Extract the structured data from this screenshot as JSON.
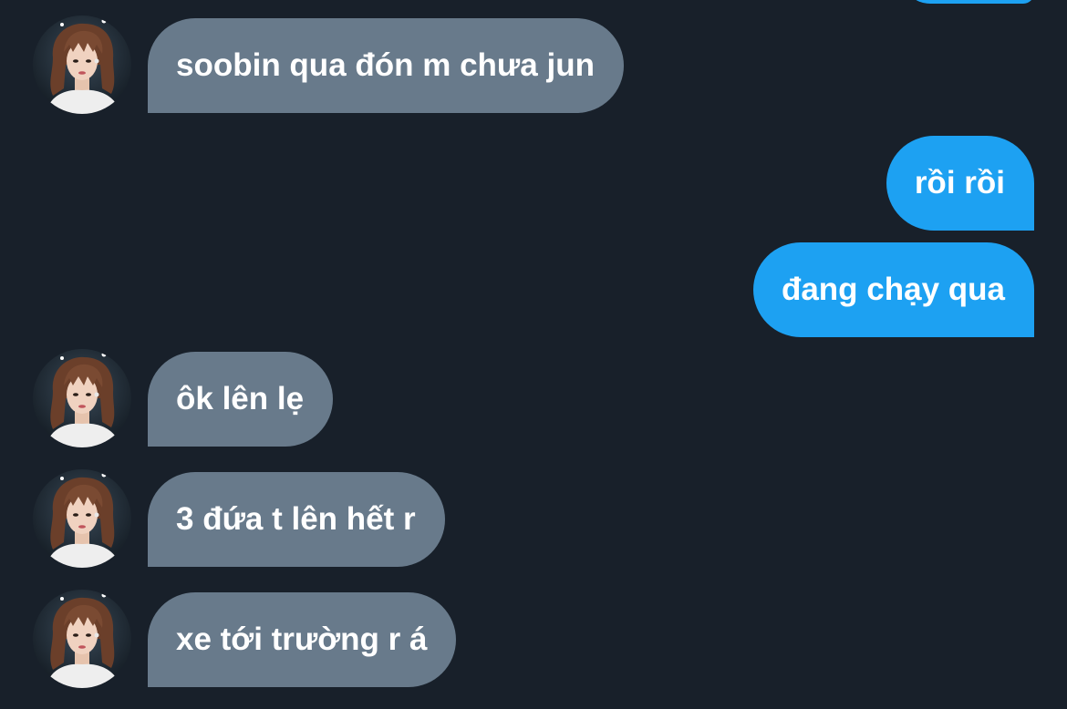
{
  "colors": {
    "background": "#18202a",
    "incoming_bubble": "#687a8b",
    "outgoing_bubble": "#1da1f2",
    "text": "#ffffff"
  },
  "avatar_icon": "profile-photo",
  "messages": [
    {
      "direction": "incoming",
      "text": "soobin qua đón m chưa jun"
    },
    {
      "direction": "outgoing",
      "text": "rồi rồi"
    },
    {
      "direction": "outgoing",
      "text": "đang chạy qua"
    },
    {
      "direction": "incoming",
      "text": "ôk lên lẹ"
    },
    {
      "direction": "incoming",
      "text": "3 đứa t lên hết r"
    },
    {
      "direction": "incoming",
      "text": "xe tới trường r á"
    }
  ]
}
